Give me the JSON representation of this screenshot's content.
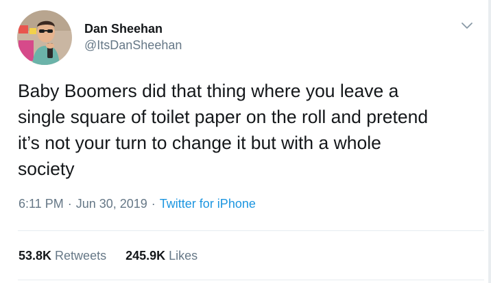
{
  "user": {
    "display_name": "Dan Sheehan",
    "handle": "@ItsDanSheehan",
    "avatar_icon": "profile-photo"
  },
  "tweet": {
    "text": "Baby Boomers did that thing where you leave a\nsingle square of toilet paper on the roll and pretend\nit’s not your turn to change it but with a whole\nsociety",
    "time": "6:11 PM",
    "date": "Jun 30, 2019",
    "separator": "·",
    "source": "Twitter for iPhone"
  },
  "stats": {
    "retweets_count": "53.8K",
    "retweets_label": "Retweets",
    "likes_count": "245.9K",
    "likes_label": "Likes"
  },
  "icons": {
    "menu": "chevron-down-icon"
  },
  "colors": {
    "text_primary": "#14171a",
    "text_secondary": "#657786",
    "link": "#1b95e0",
    "divider": "#e6ecf0"
  }
}
